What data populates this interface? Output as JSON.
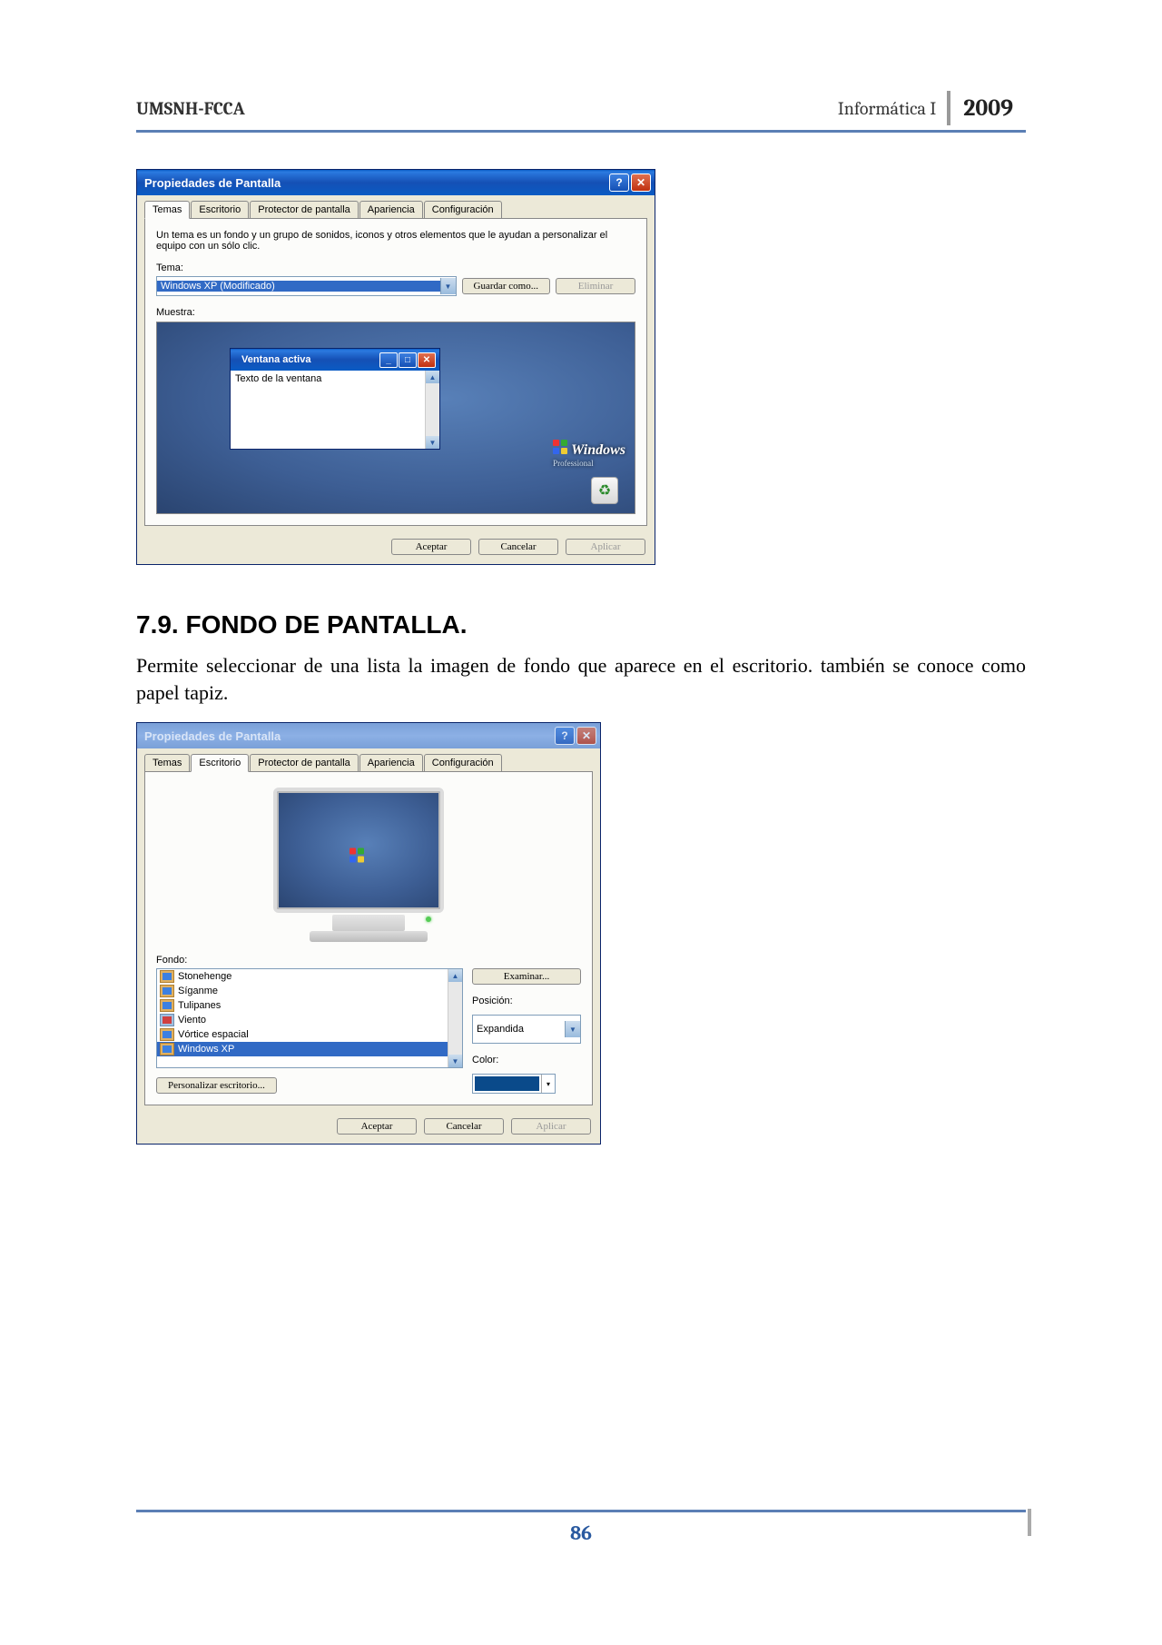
{
  "header": {
    "left": "UMSNH-FCCA",
    "right": "Informática I",
    "year": "2009"
  },
  "dialog1": {
    "title": "Propiedades de Pantalla",
    "tabs": [
      "Temas",
      "Escritorio",
      "Protector de pantalla",
      "Apariencia",
      "Configuración"
    ],
    "activeTab": 0,
    "description": "Un tema es un fondo y un grupo de sonidos, iconos y otros elementos que le ayudan a personalizar el equipo con un sólo clic.",
    "themeLabel": "Tema:",
    "themeValue": "Windows XP (Modificado)",
    "saveAs": "Guardar como...",
    "remove": "Eliminar",
    "sampleLabel": "Muestra:",
    "sampleWinTitle": "Ventana activa",
    "sampleWinText": "Texto de la ventana",
    "brand": "Windows",
    "brandSub": "Professional",
    "buttons": {
      "ok": "Aceptar",
      "cancel": "Cancelar",
      "apply": "Aplicar"
    }
  },
  "section": {
    "title": "7.9. FONDO DE PANTALLA.",
    "text": "Permite seleccionar de una lista la imagen de fondo que aparece en el escritorio. también se conoce como papel tapiz."
  },
  "dialog2": {
    "title": "Propiedades de Pantalla",
    "tabs": [
      "Temas",
      "Escritorio",
      "Protector de pantalla",
      "Apariencia",
      "Configuración"
    ],
    "activeTab": 1,
    "bgLabel": "Fondo:",
    "bgItems": [
      {
        "label": "Stonehenge",
        "type": "jpg"
      },
      {
        "label": "Síganme",
        "type": "jpg"
      },
      {
        "label": "Tulipanes",
        "type": "jpg"
      },
      {
        "label": "Viento",
        "type": "bmp"
      },
      {
        "label": "Vórtice espacial",
        "type": "jpg"
      },
      {
        "label": "Windows XP",
        "type": "jpg",
        "selected": true
      }
    ],
    "browse": "Examinar...",
    "posLabel": "Posición:",
    "posValue": "Expandida",
    "colorLabel": "Color:",
    "customize": "Personalizar escritorio...",
    "buttons": {
      "ok": "Aceptar",
      "cancel": "Cancelar",
      "apply": "Aplicar"
    }
  },
  "footer": {
    "page": "86"
  }
}
